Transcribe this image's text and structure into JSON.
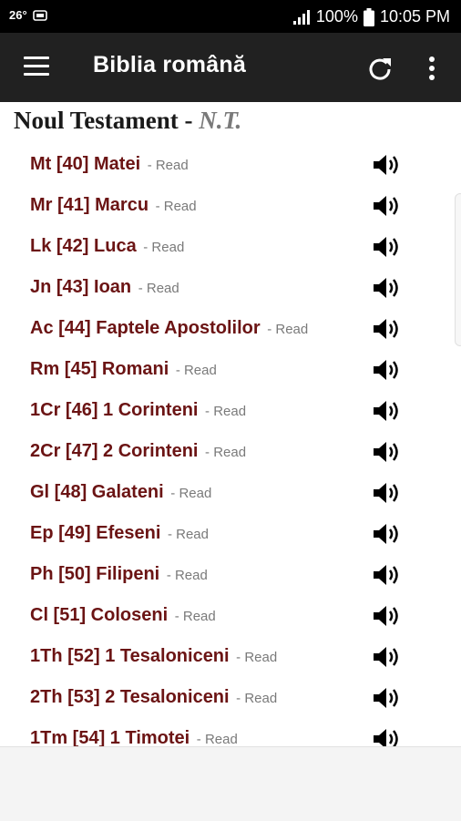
{
  "status_bar": {
    "temperature": "26°",
    "battery": "100%",
    "time": "10:05 PM"
  },
  "app_bar": {
    "title": "Biblia română",
    "icons": [
      "menu-icon",
      "refresh-icon",
      "more-vert-icon"
    ]
  },
  "section": {
    "title": "Noul Testament - ",
    "abbr": "N.T."
  },
  "books": [
    {
      "label": "Mt [40] Matei",
      "read": "- Read"
    },
    {
      "label": "Mr [41] Marcu",
      "read": "- Read"
    },
    {
      "label": "Lk [42] Luca",
      "read": "- Read"
    },
    {
      "label": "Jn [43] Ioan",
      "read": "- Read"
    },
    {
      "label": "Ac [44] Faptele Apostolilor",
      "read": "- Read"
    },
    {
      "label": "Rm [45] Romani",
      "read": "- Read"
    },
    {
      "label": "1Cr [46] 1 Corinteni",
      "read": "- Read"
    },
    {
      "label": "2Cr [47] 2 Corinteni",
      "read": "- Read"
    },
    {
      "label": "Gl [48] Galateni",
      "read": "- Read"
    },
    {
      "label": "Ep [49] Efeseni",
      "read": "- Read"
    },
    {
      "label": "Ph [50] Filipeni",
      "read": "- Read"
    },
    {
      "label": "Cl [51] Coloseni",
      "read": "- Read"
    },
    {
      "label": "1Th [52] 1 Tesaloniceni",
      "read": "- Read"
    },
    {
      "label": "2Th [53] 2 Tesaloniceni",
      "read": "- Read"
    },
    {
      "label": "1Tm [54] 1 Timotei",
      "read": "- Read"
    }
  ],
  "colors": {
    "book_text": "#6b1414",
    "app_bar": "#212121",
    "read_text": "#7a7a7a"
  }
}
